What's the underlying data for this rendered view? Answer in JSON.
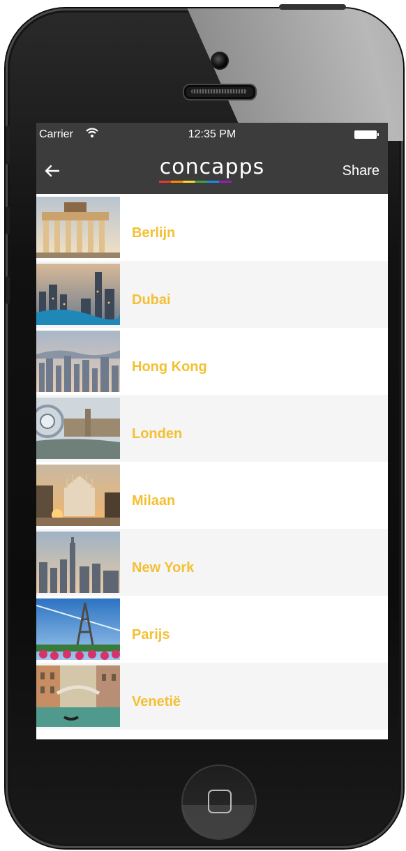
{
  "status_bar": {
    "carrier": "Carrier",
    "time": "12:35 PM"
  },
  "nav": {
    "back_icon": "back-arrow-icon",
    "logo_text": "concapps",
    "share_label": "Share"
  },
  "colors": {
    "bar_bg": "#3c3c3c",
    "city_text": "#f4c033",
    "alt_row": "#f5f5f5"
  },
  "cities": [
    {
      "name": "Berlijn"
    },
    {
      "name": "Dubai"
    },
    {
      "name": "Hong  Kong"
    },
    {
      "name": "Londen"
    },
    {
      "name": "Milaan"
    },
    {
      "name": "New York"
    },
    {
      "name": "Parijs"
    },
    {
      "name": "Venetië"
    }
  ]
}
